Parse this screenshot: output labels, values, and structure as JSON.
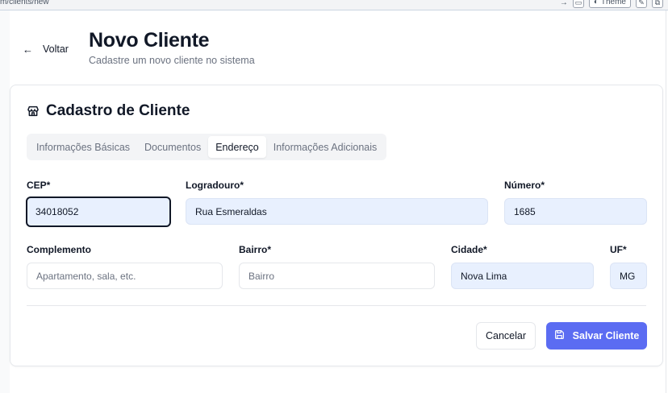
{
  "browser": {
    "url_fragment": "m/clients/new",
    "theme_label": "Theme"
  },
  "header": {
    "back_label": "Voltar",
    "title": "Novo Cliente",
    "subtitle": "Cadastre um novo cliente no sistema"
  },
  "card": {
    "title": "Cadastro de Cliente",
    "icon": "store-icon"
  },
  "tabs": [
    {
      "label": "Informações Básicas",
      "active": false
    },
    {
      "label": "Documentos",
      "active": false
    },
    {
      "label": "Endereço",
      "active": true
    },
    {
      "label": "Informações Adicionais",
      "active": false
    }
  ],
  "form": {
    "cep": {
      "label": "CEP*",
      "value": "34018052"
    },
    "logradouro": {
      "label": "Logradouro*",
      "value": "Rua Esmeraldas"
    },
    "numero": {
      "label": "Número*",
      "value": "1685"
    },
    "complemento": {
      "label": "Complemento",
      "placeholder": "Apartamento, sala, etc."
    },
    "bairro": {
      "label": "Bairro*",
      "placeholder": "Bairro"
    },
    "cidade": {
      "label": "Cidade*",
      "value": "Nova Lima"
    },
    "uf": {
      "label": "UF*",
      "value": "MG"
    }
  },
  "actions": {
    "cancel_label": "Cancelar",
    "save_label": "Salvar Cliente"
  },
  "colors": {
    "primary": "#5b6cf2",
    "autofill_bg": "#e8f0fe"
  }
}
